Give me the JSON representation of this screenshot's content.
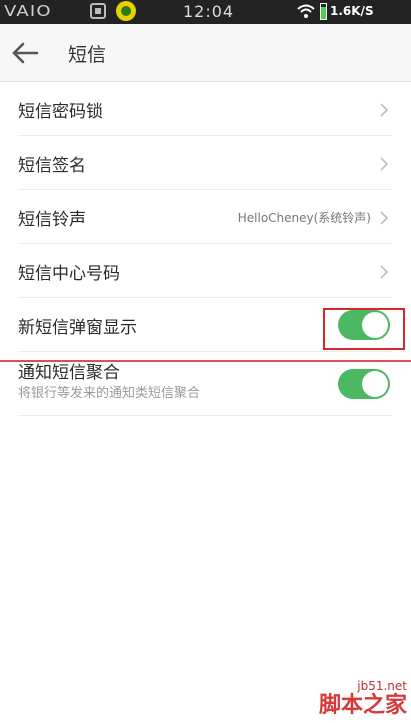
{
  "status_bar": {
    "brand": "VAIO",
    "time": "12:04",
    "speed": "1.6K/S"
  },
  "header": {
    "back_icon": "arrow-left-icon",
    "title": "短信"
  },
  "rows": [
    {
      "label": "短信密码锁"
    },
    {
      "label": "短信签名"
    },
    {
      "label": "短信铃声",
      "value": "HelloCheney(系统铃声)"
    },
    {
      "label": "短信中心号码"
    },
    {
      "label": "新短信弹窗显示",
      "toggle": "on"
    },
    {
      "label": "通知短信聚合",
      "sub": "将银行等发来的通知类短信聚合",
      "toggle": "on"
    }
  ],
  "colors": {
    "toggle_on": "#4db863",
    "highlight": "#d9262a"
  },
  "watermark": {
    "url": "jb51.net",
    "name": "脚本之家"
  }
}
